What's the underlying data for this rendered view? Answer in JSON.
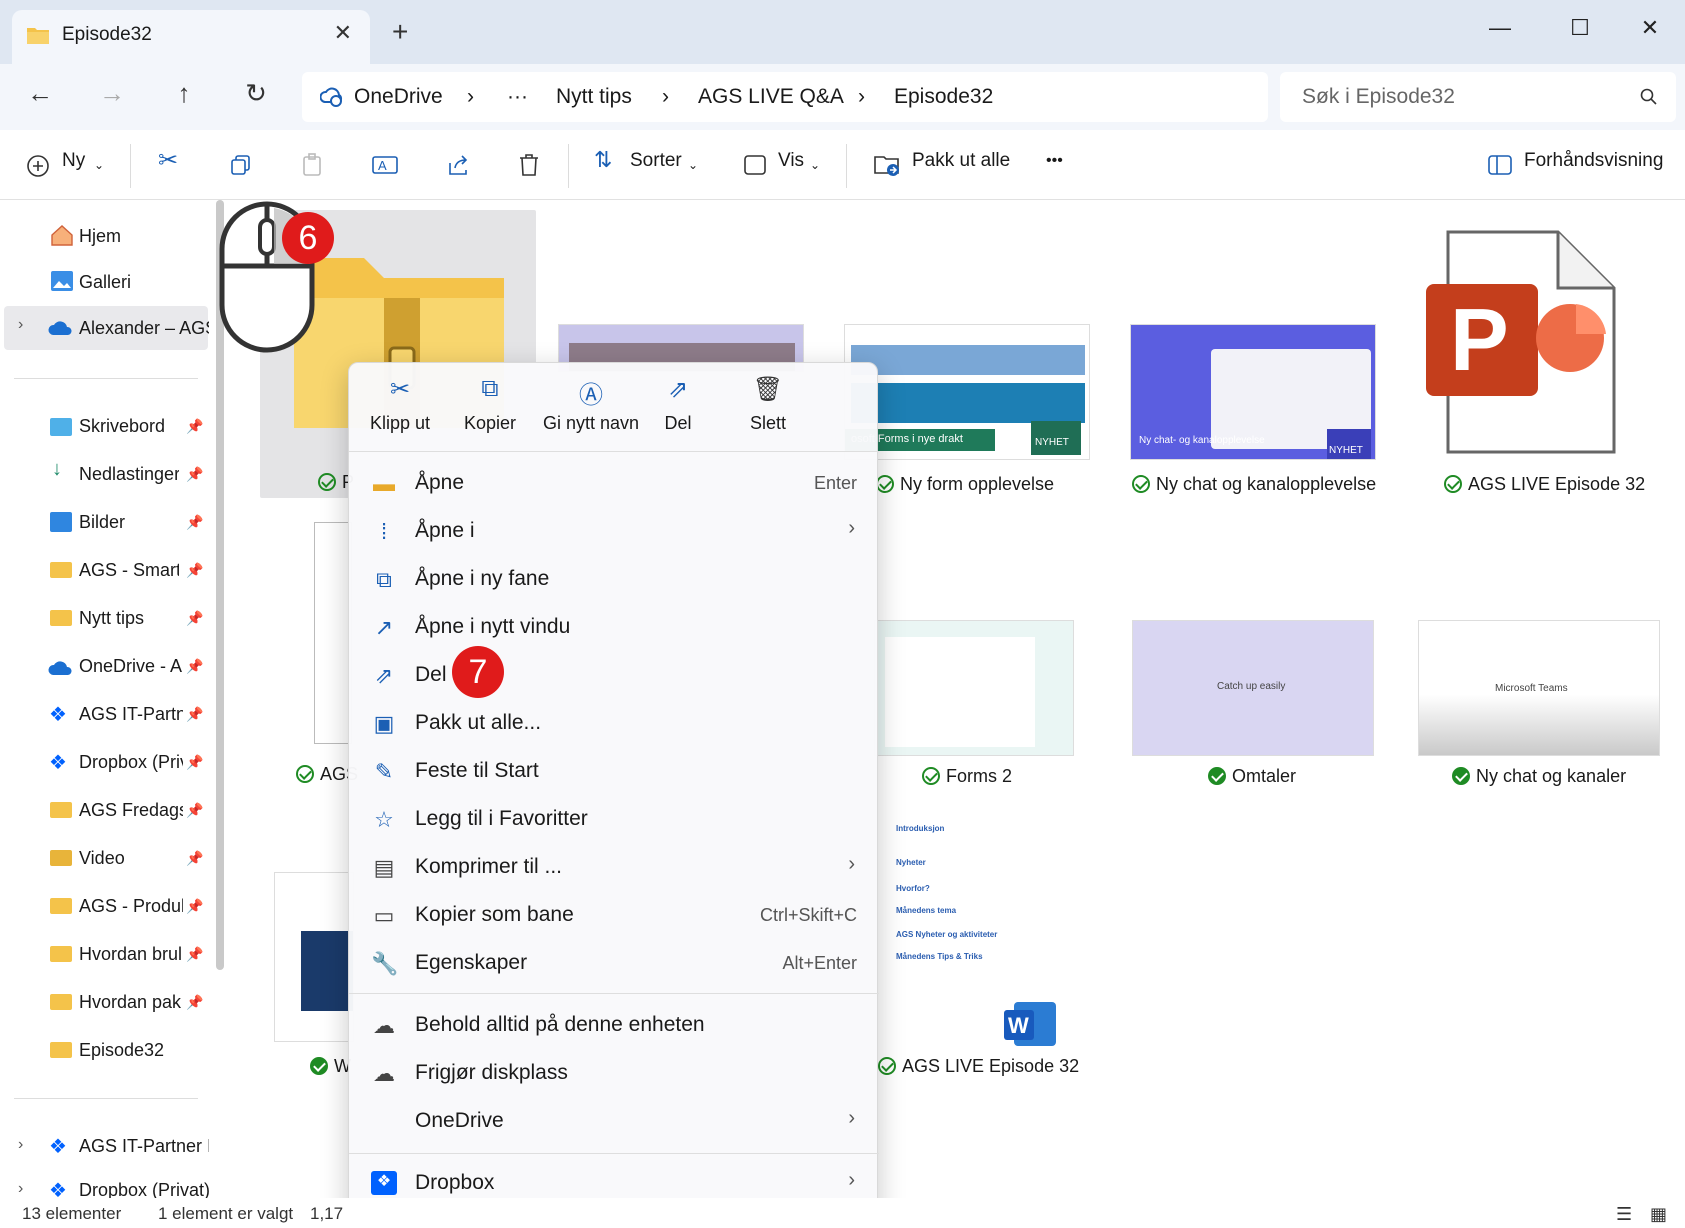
{
  "window": {
    "tab_title": "Episode32",
    "new_tab": "+",
    "controls": {
      "minimize": "—",
      "maximize": "☐",
      "close": "✕"
    }
  },
  "address": {
    "crumbs": [
      "OneDrive",
      "›",
      "···",
      "Nytt tips",
      "›",
      "AGS LIVE Q&A",
      "›",
      "Episode32"
    ],
    "search_placeholder": "Søk i Episode32"
  },
  "toolbar": {
    "new_label": "Ny",
    "sort_label": "Sorter",
    "view_label": "Vis",
    "extract_label": "Pakk ut alle",
    "more": "•••",
    "preview_label": "Forhåndsvisning"
  },
  "sidebar": {
    "top": [
      {
        "label": "Hjem",
        "icon": "home-icon"
      },
      {
        "label": "Galleri",
        "icon": "gallery-icon"
      },
      {
        "label": "Alexander – AGS",
        "icon": "onedrive-icon"
      }
    ],
    "pinned": [
      {
        "label": "Skrivebord",
        "icon": "desktop-icon"
      },
      {
        "label": "Nedlastinger",
        "icon": "download-icon"
      },
      {
        "label": "Bilder",
        "icon": "pictures-icon"
      },
      {
        "label": "AGS - Smart",
        "icon": "folder-icon"
      },
      {
        "label": "Nytt tips",
        "icon": "folder-icon"
      },
      {
        "label": "OneDrive - A",
        "icon": "onedrive-icon"
      },
      {
        "label": "AGS IT-Partne",
        "icon": "dropbox-icon"
      },
      {
        "label": "Dropbox (Priv",
        "icon": "dropbox-icon"
      },
      {
        "label": "AGS Fredags",
        "icon": "folder-icon"
      },
      {
        "label": "Video",
        "icon": "video-folder-icon"
      },
      {
        "label": "AGS - Produk",
        "icon": "folder-icon"
      },
      {
        "label": "Hvordan brul",
        "icon": "folder-icon"
      },
      {
        "label": "Hvordan pak",
        "icon": "folder-icon"
      },
      {
        "label": "Episode32",
        "icon": "folder-icon"
      }
    ],
    "bottom": [
      {
        "label": "AGS IT-Partner II",
        "icon": "dropbox-icon"
      },
      {
        "label": "Dropbox (Privat)",
        "icon": "dropbox-icon"
      }
    ]
  },
  "files": {
    "zip_label_fragment": "P",
    "form": "Ny form opplevelse",
    "chat": "Ny chat og kanalopplevelse",
    "ppt": "AGS LIVE Episode 32",
    "ags_fragment": "AGS",
    "forms2": "Forms 2",
    "omtaler": "Omtaler",
    "kanaler": "Ny chat og kanaler",
    "w_fragment": "W",
    "docx": "AGS LIVE Episode 32",
    "thumb_forms_text": "osoft Forms i nye drakt",
    "thumb_chat_text": "Ny chat- og kanalopplevelse",
    "thumb_nyhet": "NYHET",
    "thumb_catch": "Catch up easily",
    "thumb_teams": "Microsoft Teams",
    "doc_lines": [
      "Introduksjon",
      "Nyheter",
      "Hvorfor?",
      "Månedens tema",
      "AGS Nyheter og aktiviteter",
      "Månedens Tips & Triks"
    ]
  },
  "context_menu": {
    "quick_actions": [
      {
        "label": "Klipp ut",
        "icon": "cut-icon"
      },
      {
        "label": "Kopier",
        "icon": "copy-icon"
      },
      {
        "label": "Gi nytt navn",
        "icon": "rename-icon"
      },
      {
        "label": "Del",
        "icon": "share-icon"
      },
      {
        "label": "Slett",
        "icon": "delete-icon"
      }
    ],
    "items": [
      {
        "label": "Åpne",
        "shortcut": "Enter",
        "icon": "folder-open-icon"
      },
      {
        "label": "Åpne i",
        "submenu": "›",
        "icon": "open-with-icon"
      },
      {
        "label": "Åpne i ny fane",
        "icon": "new-tab-icon"
      },
      {
        "label": "Åpne i nytt vindu",
        "icon": "new-window-icon"
      },
      {
        "label": "Del",
        "icon": "share-icon"
      },
      {
        "label": "Pakk ut alle...",
        "icon": "extract-icon"
      },
      {
        "label": "Feste til Start",
        "icon": "pin-icon"
      },
      {
        "label": "Legg til i Favoritter",
        "icon": "star-icon"
      },
      {
        "label": "Komprimer til ...",
        "submenu": "›",
        "icon": "compress-icon"
      },
      {
        "label": "Kopier som bane",
        "shortcut": "Ctrl+Skift+C",
        "icon": "copy-path-icon"
      },
      {
        "label": "Egenskaper",
        "shortcut": "Alt+Enter",
        "icon": "properties-icon"
      },
      {
        "label": "Behold alltid på denne enheten",
        "icon": "keep-device-icon"
      },
      {
        "label": "Frigjør diskplass",
        "icon": "cloud-icon"
      },
      {
        "label": "OneDrive",
        "submenu": "›",
        "icon": "onedrive-menu-icon"
      },
      {
        "label": "Dropbox",
        "submenu": "›",
        "icon": "dropbox-icon"
      }
    ]
  },
  "badges": {
    "six": "6",
    "seven": "7"
  },
  "status": {
    "count": "13 elementer",
    "selected": "1 element er valgt",
    "size": "1,17"
  },
  "colors": {
    "accent": "#1b5fb4",
    "badge": "#e01b1b",
    "sync_ok": "#1f8b24",
    "folder": "#f4c34a"
  }
}
